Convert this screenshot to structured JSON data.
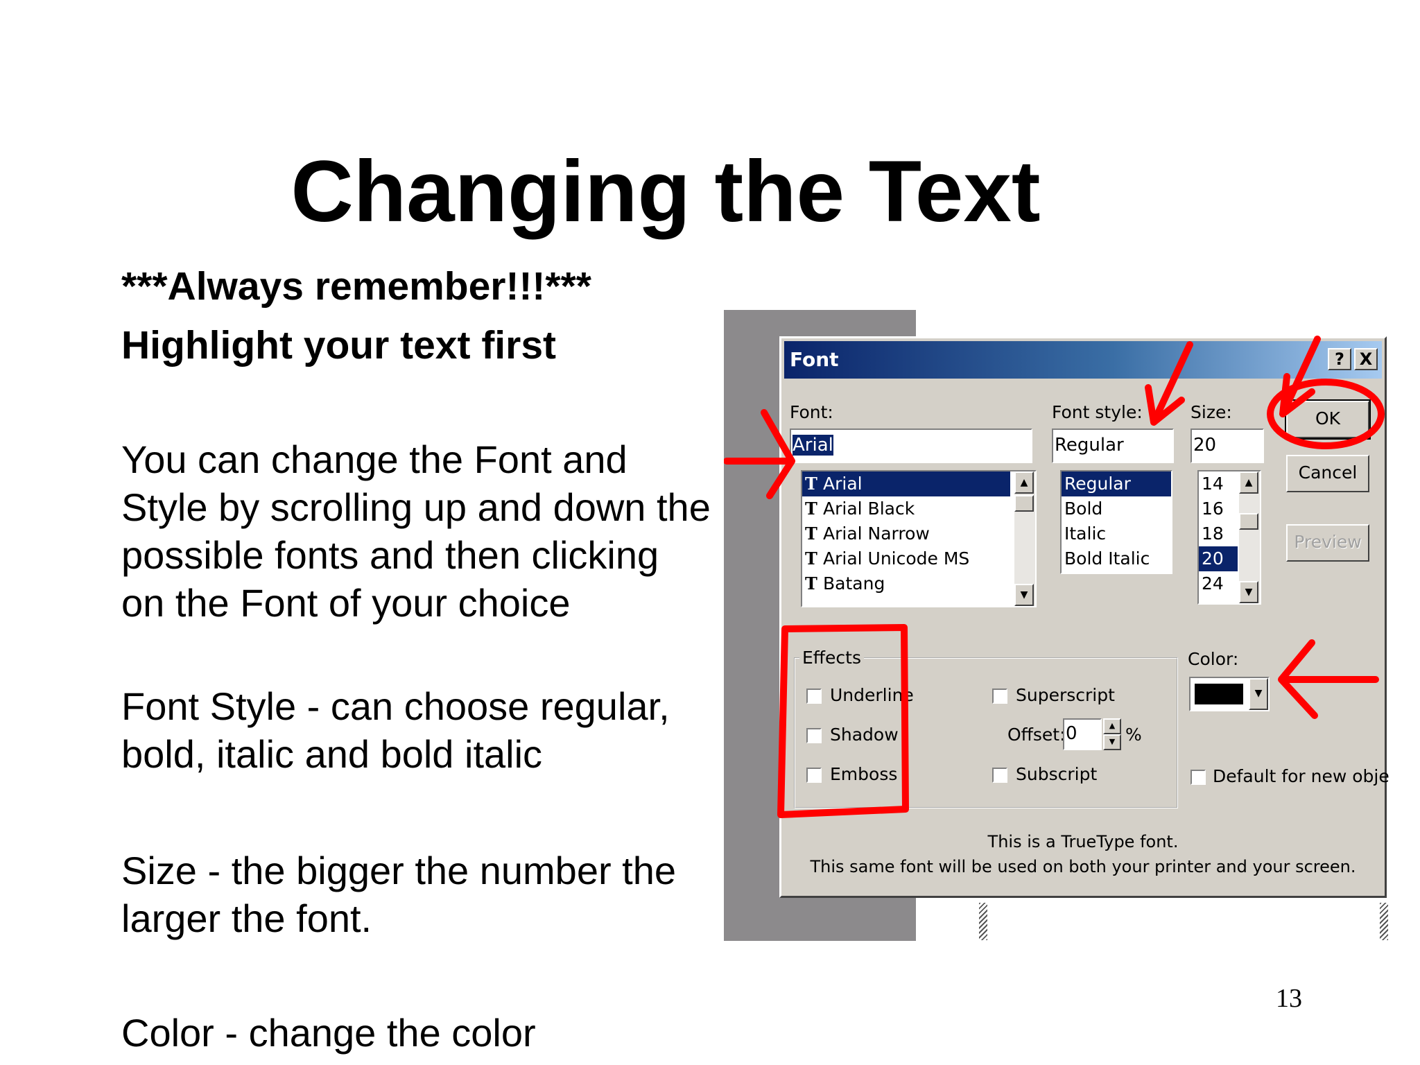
{
  "slide": {
    "title": "Changing the Text",
    "reminder": "***Always remember!!!***",
    "highlight": "Highlight your text first",
    "font_paragraph": "You can change the Font  and Style by scrolling up and down the possible fonts and then clicking on the Font of your choice",
    "style_paragraph": "Font Style - can choose regular, bold, italic and bold italic",
    "size_paragraph": "Size - the bigger the number the larger the font.",
    "color_paragraph": "Color - change the color",
    "page_number": "13"
  },
  "dialog": {
    "title": "Font",
    "help_button": "?",
    "close_button": "X",
    "font_label": "Font:",
    "font_value": "Arial",
    "font_list": [
      "Arial",
      "Arial Black",
      "Arial Narrow",
      "Arial Unicode MS",
      "Batang"
    ],
    "font_selected": "Arial",
    "style_label": "Font style:",
    "style_value": "Regular",
    "style_list": [
      "Regular",
      "Bold",
      "Italic",
      "Bold Italic"
    ],
    "style_selected": "Regular",
    "size_label": "Size:",
    "size_value": "20",
    "size_list": [
      "14",
      "16",
      "18",
      "20",
      "24"
    ],
    "size_selected": "20",
    "ok_label": "OK",
    "cancel_label": "Cancel",
    "preview_label": "Preview",
    "effects_label": "Effects",
    "underline_label": "Underline",
    "shadow_label": "Shadow",
    "emboss_label": "Emboss",
    "superscript_label": "Superscript",
    "offset_label": "Offset:",
    "offset_value": "0",
    "percent_label": "%",
    "subscript_label": "Subscript",
    "color_label": "Color:",
    "color_value": "#000000",
    "default_objects_label": "Default for new objects",
    "info_line1": "This is a TrueType font.",
    "info_line2": "This same font will be used on both your printer and your screen."
  },
  "colors": {
    "annotation_red": "#ff0000",
    "selection_blue": "#0a246a",
    "dialog_face": "#d4d0c8"
  }
}
